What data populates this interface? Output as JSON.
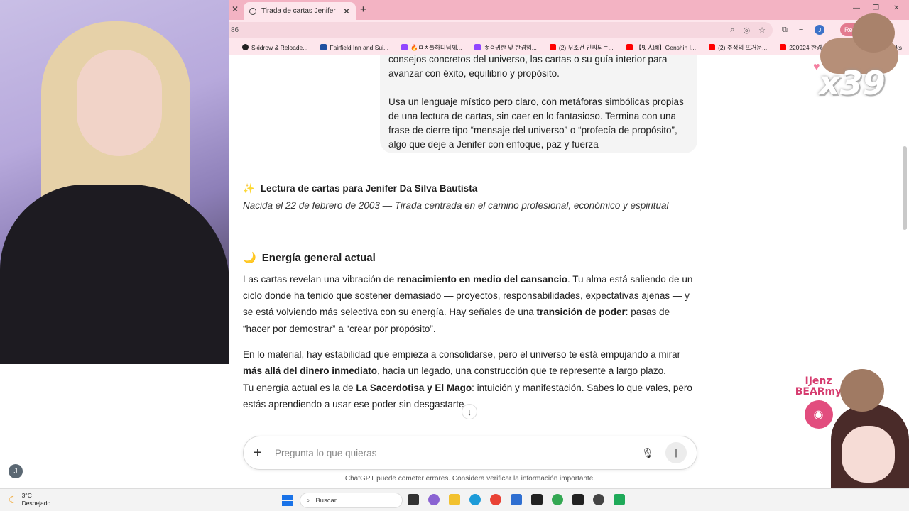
{
  "browser": {
    "tab_title": "Tirada de cartas Jenifer",
    "new_tab": "+",
    "url_fragment": "86",
    "relaunch_label": "Relau",
    "profile_initial": "J",
    "bookmarks": [
      {
        "label": "Skidrow & Reloade...",
        "color": "#222222"
      },
      {
        "label": "Fairfield Inn and Sui...",
        "color": "#1f4fa0"
      },
      {
        "label": "🔥ㅁㅊ톨하디님께...",
        "color": "#9146ff"
      },
      {
        "label": "ㅎㅇ귀한 낮 한경임...",
        "color": "#9146ff"
      },
      {
        "label": "(2) 무조건 인싸되는...",
        "color": "#ff0000"
      },
      {
        "label": "【빗人圓】Genshin I...",
        "color": "#ff0000"
      },
      {
        "label": "(2) 추정의 뜨거운...",
        "color": "#ff0000"
      },
      {
        "label": "220924 한경 제토투...",
        "color": "#ff0000"
      }
    ],
    "bookmarks_end": "rks"
  },
  "chat": {
    "user_message": {
      "partial_line": "consejos concretos del universo, las cartas o su guía interior para",
      "line_2": "avanzar con éxito, equilibrio y propósito.",
      "paragraph_2": "Usa un lenguaje místico pero claro, con metáforas simbólicas propias de una lectura de cartas, sin caer en lo fantasioso. Termina con una frase de cierre tipo “mensaje del universo” o “profecía de propósito”, algo que deje a Jenifer con enfoque, paz y fuerza"
    },
    "reading_title_emoji": "✨",
    "reading_title": "Lectura de cartas para Jenifer Da Silva Bautista",
    "reading_subtitle": "Nacida el 22 de febrero de 2003 — Tirada centrada en el camino profesional, económico y espiritual",
    "energy_emoji": "🌙",
    "energy_heading": "Energía general actual",
    "p1": {
      "a": "Las cartas revelan una vibración de ",
      "b": "renacimiento en medio del cansancio",
      "c": ". Tu alma está saliendo de un ciclo donde ha tenido que sostener demasiado — proyectos, responsabilidades, expectativas ajenas — y se está volviendo más selectiva con su energía. Hay señales de una ",
      "d": "transición de poder",
      "e": ": pasas de “hacer por demostrar” a “crear por propósito”."
    },
    "p2": {
      "a": "En lo material, hay estabilidad que empieza a consolidarse, pero el universo te está empujando a mirar ",
      "b": "más allá del dinero inmediato",
      "c": ", hacia un legado, una construcción que te represente a largo plazo."
    },
    "p3": {
      "a": "Tu energía actual es la de ",
      "b": "La Sacerdotisa y El Mago",
      "c": ": intuición y manifestación. Sabes lo que vales, pero estás aprendiendo a usar ese poder sin desgastarte."
    },
    "composer_placeholder": "Pregunta lo que quieras",
    "disclaimer": "ChatGPT puede cometer errores. Considera verificar la información importante.",
    "user_avatar_initial": "J"
  },
  "overlay": {
    "combo_count": "x39",
    "discord_name_1": "IJenz",
    "discord_name_2": "BEARmy"
  },
  "taskbar": {
    "temperature": "3°C",
    "weather": "Despejado",
    "search_label": "Buscar"
  }
}
